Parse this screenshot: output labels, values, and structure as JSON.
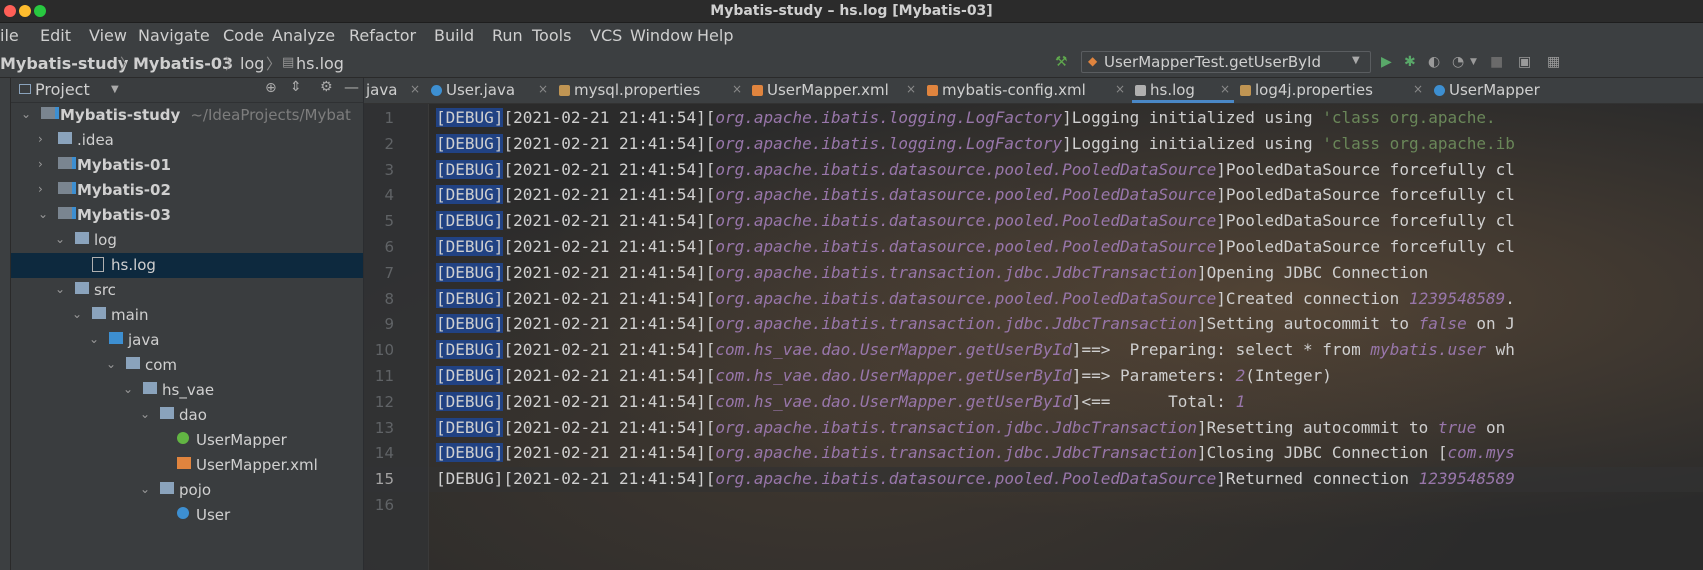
{
  "window": {
    "title": "Mybatis-study – hs.log [Mybatis-03]"
  },
  "menu": [
    "ile",
    "Edit",
    "View",
    "Navigate",
    "Code",
    "Analyze",
    "Refactor",
    "Build",
    "Run",
    "Tools",
    "VCS",
    "Window",
    "Help"
  ],
  "breadcrumb": [
    "Mybatis-study",
    "Mybatis-03",
    "log",
    "hs.log"
  ],
  "toolbar": {
    "run_config": "UserMapperTest.getUserById"
  },
  "project": {
    "title": "Project",
    "tree": [
      {
        "label": "Mybatis-study",
        "path": "~/IdeaProjects/Mybat",
        "depth": 0,
        "expanded": true,
        "icon": "module-icon",
        "bold": true
      },
      {
        "label": ".idea",
        "depth": 1,
        "expanded": false,
        "icon": "folder-icon"
      },
      {
        "label": "Mybatis-01",
        "depth": 1,
        "expanded": false,
        "icon": "module-icon",
        "bold": true
      },
      {
        "label": "Mybatis-02",
        "depth": 1,
        "expanded": false,
        "icon": "module-icon",
        "bold": true
      },
      {
        "label": "Mybatis-03",
        "depth": 1,
        "expanded": true,
        "icon": "module-icon",
        "bold": true
      },
      {
        "label": "log",
        "depth": 2,
        "expanded": true,
        "icon": "folder-icon"
      },
      {
        "label": "hs.log",
        "depth": 3,
        "icon": "file-icon",
        "selected": true
      },
      {
        "label": "src",
        "depth": 2,
        "expanded": true,
        "icon": "folder-icon"
      },
      {
        "label": "main",
        "depth": 3,
        "expanded": true,
        "icon": "folder-icon"
      },
      {
        "label": "java",
        "depth": 4,
        "expanded": true,
        "icon": "source-folder-icon"
      },
      {
        "label": "com",
        "depth": 5,
        "expanded": true,
        "icon": "package-icon"
      },
      {
        "label": "hs_vae",
        "depth": 6,
        "expanded": true,
        "icon": "package-icon"
      },
      {
        "label": "dao",
        "depth": 7,
        "expanded": true,
        "icon": "package-icon"
      },
      {
        "label": "UserMapper",
        "depth": 8,
        "icon": "interface-icon"
      },
      {
        "label": "UserMapper.xml",
        "depth": 8,
        "icon": "xml-icon"
      },
      {
        "label": "pojo",
        "depth": 7,
        "expanded": true,
        "icon": "package-icon"
      },
      {
        "label": "User",
        "depth": 8,
        "icon": "class-icon"
      }
    ]
  },
  "tabs": [
    {
      "label": "java",
      "icon": "",
      "active": false
    },
    {
      "label": "User.java",
      "icon": "class-icon",
      "active": false
    },
    {
      "label": "mysql.properties",
      "icon": "properties-icon",
      "active": false
    },
    {
      "label": "UserMapper.xml",
      "icon": "xml-icon",
      "active": false
    },
    {
      "label": "mybatis-config.xml",
      "icon": "xml-icon",
      "active": false
    },
    {
      "label": "hs.log",
      "icon": "file-icon",
      "active": true
    },
    {
      "label": "log4j.properties",
      "icon": "properties-icon",
      "active": false
    },
    {
      "label": "UserMapper",
      "icon": "class-icon",
      "active": false
    }
  ],
  "editor": {
    "current_line": 15,
    "lines": [
      {
        "n": "1",
        "level": "[DEBUG]",
        "time": "[2021-02-21 21:41:54]",
        "cls": "org.apache.ibatis.logging.LogFactory",
        "msg": [
          [
            "Logging initialized using ",
            ""
          ],
          [
            "'class org.apache.",
            "str"
          ]
        ]
      },
      {
        "n": "2",
        "level": "[DEBUG]",
        "time": "[2021-02-21 21:41:54]",
        "cls": "org.apache.ibatis.logging.LogFactory",
        "msg": [
          [
            "Logging initialized using ",
            ""
          ],
          [
            "'class org.apache.ib",
            "str"
          ]
        ]
      },
      {
        "n": "3",
        "level": "[DEBUG]",
        "time": "[2021-02-21 21:41:54]",
        "cls": "org.apache.ibatis.datasource.pooled.PooledDataSource",
        "msg": [
          [
            "PooledDataSource forcefully cl",
            ""
          ]
        ]
      },
      {
        "n": "4",
        "level": "[DEBUG]",
        "time": "[2021-02-21 21:41:54]",
        "cls": "org.apache.ibatis.datasource.pooled.PooledDataSource",
        "msg": [
          [
            "PooledDataSource forcefully cl",
            ""
          ]
        ]
      },
      {
        "n": "5",
        "level": "[DEBUG]",
        "time": "[2021-02-21 21:41:54]",
        "cls": "org.apache.ibatis.datasource.pooled.PooledDataSource",
        "msg": [
          [
            "PooledDataSource forcefully cl",
            ""
          ]
        ]
      },
      {
        "n": "6",
        "level": "[DEBUG]",
        "time": "[2021-02-21 21:41:54]",
        "cls": "org.apache.ibatis.datasource.pooled.PooledDataSource",
        "msg": [
          [
            "PooledDataSource forcefully cl",
            ""
          ]
        ]
      },
      {
        "n": "7",
        "level": "[DEBUG]",
        "time": "[2021-02-21 21:41:54]",
        "cls": "org.apache.ibatis.transaction.jdbc.JdbcTransaction",
        "msg": [
          [
            "Opening JDBC Connection",
            ""
          ]
        ]
      },
      {
        "n": "8",
        "level": "[DEBUG]",
        "time": "[2021-02-21 21:41:54]",
        "cls": "org.apache.ibatis.datasource.pooled.PooledDataSource",
        "msg": [
          [
            "Created connection ",
            ""
          ],
          [
            "1239548589",
            "num"
          ],
          [
            ".",
            ""
          ]
        ]
      },
      {
        "n": "9",
        "level": "[DEBUG]",
        "time": "[2021-02-21 21:41:54]",
        "cls": "org.apache.ibatis.transaction.jdbc.JdbcTransaction",
        "msg": [
          [
            "Setting autocommit to ",
            ""
          ],
          [
            "false",
            "kw"
          ],
          [
            " on J",
            ""
          ]
        ]
      },
      {
        "n": "10",
        "level": "[DEBUG]",
        "time": "[2021-02-21 21:41:54]",
        "cls": "com.hs_vae.dao.UserMapper.getUserById",
        "msg": [
          [
            "==>  Preparing: select * from ",
            ""
          ],
          [
            "mybatis.user",
            "kw"
          ],
          [
            " wh",
            ""
          ]
        ]
      },
      {
        "n": "11",
        "level": "[DEBUG]",
        "time": "[2021-02-21 21:41:54]",
        "cls": "com.hs_vae.dao.UserMapper.getUserById",
        "msg": [
          [
            "==> Parameters: ",
            ""
          ],
          [
            "2",
            "num"
          ],
          [
            "(Integer)",
            ""
          ]
        ]
      },
      {
        "n": "12",
        "level": "[DEBUG]",
        "time": "[2021-02-21 21:41:54]",
        "cls": "com.hs_vae.dao.UserMapper.getUserById",
        "msg": [
          [
            "<==      Total: ",
            ""
          ],
          [
            "1",
            "num"
          ]
        ]
      },
      {
        "n": "13",
        "level": "[DEBUG]",
        "time": "[2021-02-21 21:41:54]",
        "cls": "org.apache.ibatis.transaction.jdbc.JdbcTransaction",
        "msg": [
          [
            "Resetting autocommit to ",
            ""
          ],
          [
            "true",
            "kw"
          ],
          [
            " on ",
            ""
          ]
        ]
      },
      {
        "n": "14",
        "level": "[DEBUG]",
        "time": "[2021-02-21 21:41:54]",
        "cls": "org.apache.ibatis.transaction.jdbc.JdbcTransaction",
        "msg": [
          [
            "Closing JDBC Connection [",
            ""
          ],
          [
            "com.mys",
            "kw"
          ]
        ]
      },
      {
        "n": "15",
        "level": "[DEBUG]",
        "time": "[2021-02-21 21:41:54]",
        "cls": "org.apache.ibatis.datasource.pooled.PooledDataSource",
        "msg": [
          [
            "Returned connection ",
            ""
          ],
          [
            "1239548589",
            "num"
          ]
        ]
      },
      {
        "n": "16",
        "level": "",
        "time": "",
        "cls": "",
        "msg": []
      }
    ]
  },
  "colors": {
    "accent": "#4a88c7",
    "selection": "#214283",
    "tree_selected": "#0d293e",
    "folder": "#8aa3bc",
    "module": "#3d8fd1"
  }
}
